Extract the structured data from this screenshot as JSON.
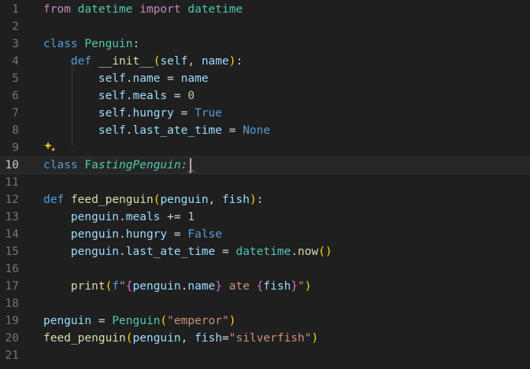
{
  "editor": {
    "active_line": 10,
    "lines": [
      {
        "n": "1",
        "tokens": [
          [
            "from",
            "ctl"
          ],
          [
            " ",
            ""
          ],
          [
            "datetime",
            "cls"
          ],
          [
            " ",
            ""
          ],
          [
            "import",
            "ctl"
          ],
          [
            " ",
            ""
          ],
          [
            "datetime",
            "cls"
          ]
        ]
      },
      {
        "n": "2",
        "tokens": []
      },
      {
        "n": "3",
        "tokens": [
          [
            "class",
            "kw"
          ],
          [
            " ",
            ""
          ],
          [
            "Penguin",
            "cls"
          ],
          [
            ":",
            "punc"
          ]
        ]
      },
      {
        "n": "4",
        "tokens": [
          [
            "    ",
            ""
          ],
          [
            "def",
            "kw"
          ],
          [
            " ",
            ""
          ],
          [
            "__init__",
            "fn"
          ],
          [
            "(",
            "brk"
          ],
          [
            "self",
            "var"
          ],
          [
            ", ",
            "punc"
          ],
          [
            "name",
            "var"
          ],
          [
            ")",
            "brk"
          ],
          [
            ":",
            "punc"
          ]
        ]
      },
      {
        "n": "5",
        "tokens": [
          [
            "        ",
            ""
          ],
          [
            "self",
            "var"
          ],
          [
            ".",
            "punc"
          ],
          [
            "name",
            "var"
          ],
          [
            " = ",
            "punc"
          ],
          [
            "name",
            "var"
          ]
        ]
      },
      {
        "n": "6",
        "tokens": [
          [
            "        ",
            ""
          ],
          [
            "self",
            "var"
          ],
          [
            ".",
            "punc"
          ],
          [
            "meals",
            "var"
          ],
          [
            " = ",
            "punc"
          ],
          [
            "0",
            "num"
          ]
        ]
      },
      {
        "n": "7",
        "tokens": [
          [
            "        ",
            ""
          ],
          [
            "self",
            "var"
          ],
          [
            ".",
            "punc"
          ],
          [
            "hungry",
            "var"
          ],
          [
            " = ",
            "punc"
          ],
          [
            "True",
            "kw"
          ]
        ]
      },
      {
        "n": "8",
        "tokens": [
          [
            "        ",
            ""
          ],
          [
            "self",
            "var"
          ],
          [
            ".",
            "punc"
          ],
          [
            "last_ate_time",
            "var"
          ],
          [
            " = ",
            "punc"
          ],
          [
            "None",
            "kw"
          ]
        ]
      },
      {
        "n": "9",
        "tokens": []
      },
      {
        "n": "10",
        "tokens": [
          [
            "class",
            "kw"
          ],
          [
            " ",
            ""
          ],
          [
            "Fa",
            "cls"
          ],
          [
            "stingPenguin:",
            "cls it"
          ],
          [
            " ",
            "sq"
          ]
        ]
      },
      {
        "n": "11",
        "tokens": []
      },
      {
        "n": "12",
        "tokens": [
          [
            "def",
            "kw"
          ],
          [
            " ",
            ""
          ],
          [
            "feed_penguin",
            "fn"
          ],
          [
            "(",
            "brk"
          ],
          [
            "penguin",
            "var"
          ],
          [
            ", ",
            "punc"
          ],
          [
            "fish",
            "var"
          ],
          [
            ")",
            "brk"
          ],
          [
            ":",
            "punc"
          ]
        ]
      },
      {
        "n": "13",
        "tokens": [
          [
            "    ",
            ""
          ],
          [
            "penguin",
            "var"
          ],
          [
            ".",
            "punc"
          ],
          [
            "meals",
            "var"
          ],
          [
            " += ",
            "punc"
          ],
          [
            "1",
            "num"
          ]
        ]
      },
      {
        "n": "14",
        "tokens": [
          [
            "    ",
            ""
          ],
          [
            "penguin",
            "var"
          ],
          [
            ".",
            "punc"
          ],
          [
            "hungry",
            "var"
          ],
          [
            " = ",
            "punc"
          ],
          [
            "False",
            "kw"
          ]
        ]
      },
      {
        "n": "15",
        "tokens": [
          [
            "    ",
            ""
          ],
          [
            "penguin",
            "var"
          ],
          [
            ".",
            "punc"
          ],
          [
            "last_ate_time",
            "var"
          ],
          [
            " = ",
            "punc"
          ],
          [
            "datetime",
            "cls"
          ],
          [
            ".",
            "punc"
          ],
          [
            "now",
            "fn"
          ],
          [
            "(",
            "brk"
          ],
          [
            ")",
            "brk"
          ]
        ]
      },
      {
        "n": "16",
        "tokens": []
      },
      {
        "n": "17",
        "tokens": [
          [
            "    ",
            ""
          ],
          [
            "print",
            "fn"
          ],
          [
            "(",
            "brk"
          ],
          [
            "f",
            "kw"
          ],
          [
            "\"",
            "str"
          ],
          [
            "{",
            "brk2"
          ],
          [
            "penguin",
            "var"
          ],
          [
            ".",
            "punc"
          ],
          [
            "name",
            "var"
          ],
          [
            "}",
            "brk2"
          ],
          [
            " ate ",
            "str"
          ],
          [
            "{",
            "brk2"
          ],
          [
            "fish",
            "var"
          ],
          [
            "}",
            "brk2"
          ],
          [
            "\"",
            "str"
          ],
          [
            ")",
            "brk"
          ]
        ]
      },
      {
        "n": "18",
        "tokens": []
      },
      {
        "n": "19",
        "tokens": [
          [
            "penguin",
            "var"
          ],
          [
            " = ",
            "punc"
          ],
          [
            "Penguin",
            "cls"
          ],
          [
            "(",
            "brk"
          ],
          [
            "\"emperor\"",
            "str"
          ],
          [
            ")",
            "brk"
          ]
        ]
      },
      {
        "n": "20",
        "tokens": [
          [
            "feed_penguin",
            "fn"
          ],
          [
            "(",
            "brk"
          ],
          [
            "penguin",
            "var"
          ],
          [
            ", ",
            "punc"
          ],
          [
            "fish",
            "var"
          ],
          [
            "=",
            "punc"
          ],
          [
            "\"silverfish\"",
            "str"
          ],
          [
            ")",
            "brk"
          ]
        ]
      },
      {
        "n": "21",
        "tokens": []
      }
    ],
    "gutter_icon": "sparkle-icon",
    "colors": {
      "background": "#1f1f1f",
      "keyword": "#569cd6",
      "control": "#c586c0",
      "class": "#4ec9b0",
      "function": "#dcdcaa",
      "variable": "#9cdcfe",
      "string": "#ce9178",
      "number": "#b5cea8"
    }
  }
}
